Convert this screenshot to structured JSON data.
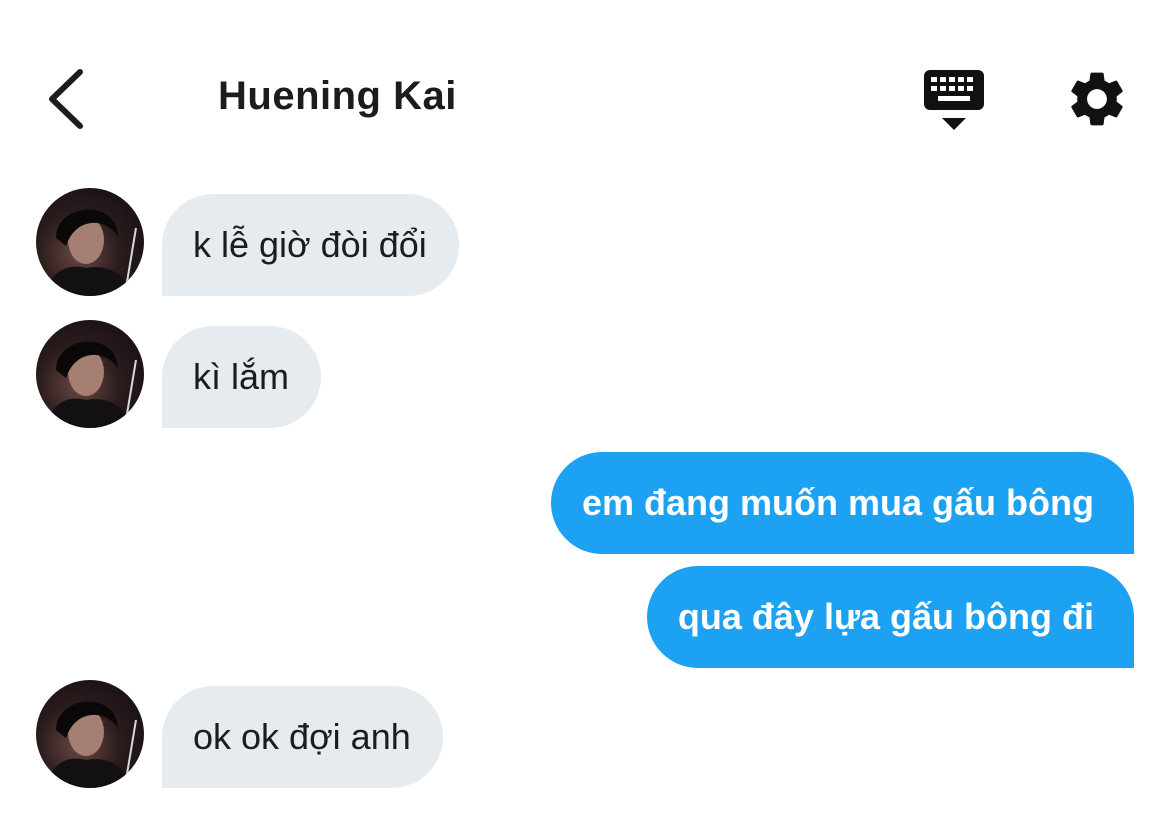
{
  "header": {
    "title": "Huening Kai",
    "back_icon": "chevron-left-icon",
    "keyboard_icon": "keyboard-hide-icon",
    "settings_icon": "gear-icon"
  },
  "colors": {
    "incoming_bubble": "#e6ebef",
    "outgoing_bubble": "#1da1f2",
    "text_dark": "#1c1c1e",
    "text_light": "#ffffff"
  },
  "messages": [
    {
      "direction": "incoming",
      "text": "k lễ giờ đòi đổi"
    },
    {
      "direction": "incoming",
      "text": "kì lắm"
    },
    {
      "direction": "outgoing",
      "text": "em đang muốn mua gấu bông"
    },
    {
      "direction": "outgoing",
      "text": "qua đây lựa gấu bông đi"
    },
    {
      "direction": "incoming",
      "text": "ok ok đợi anh"
    }
  ]
}
